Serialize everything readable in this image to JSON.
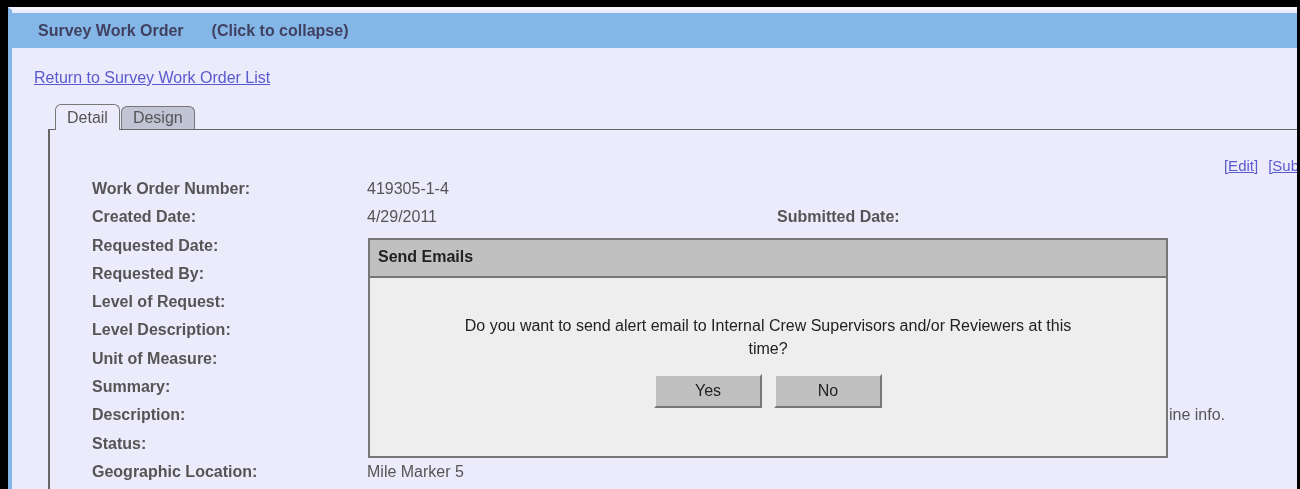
{
  "section": {
    "title": "Survey Work Order",
    "collapse_hint": "(Click to collapse)"
  },
  "return_link": "Return to Survey Work Order List",
  "tabs": [
    {
      "label": "Detail",
      "selected": true
    },
    {
      "label": "Design",
      "selected": false
    }
  ],
  "actions": [
    "[Edit]",
    "[Sub"
  ],
  "fields": [
    {
      "label": "Work Order Number:",
      "value": "419305-1-4"
    },
    {
      "label": "Created Date:",
      "value": "4/29/2011",
      "right_label": "Submitted Date:"
    },
    {
      "label": "Requested Date:"
    },
    {
      "label": "Requested By:"
    },
    {
      "label": "Level of Request:"
    },
    {
      "label": "Level Description:"
    },
    {
      "label": "Unit of Measure:"
    },
    {
      "label": "Summary:"
    },
    {
      "label": "Description:",
      "right_value": "ine info."
    },
    {
      "label": "Status:"
    },
    {
      "label": "Geographic Location:",
      "value": "Mile Marker 5"
    }
  ],
  "dialog": {
    "title": "Send Emails",
    "message": "Do you want to send alert email to Internal Crew Supervisors and/or Reviewers at this time?",
    "buttons": [
      "Yes",
      "No"
    ]
  }
}
